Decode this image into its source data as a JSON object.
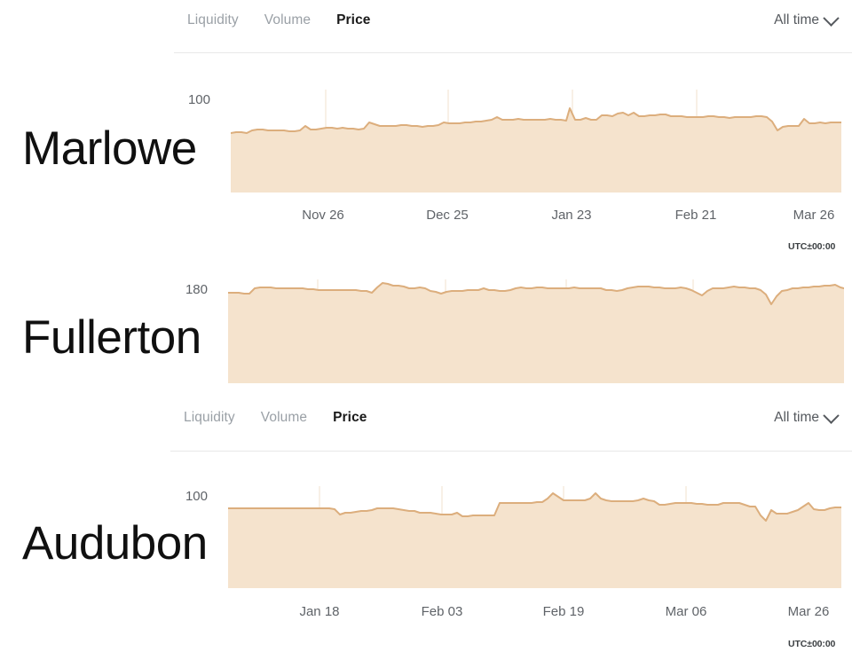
{
  "nav_primary": {
    "tabs": [
      {
        "label": "Liquidity",
        "active": false
      },
      {
        "label": "Volume",
        "active": false
      },
      {
        "label": "Price",
        "active": true
      }
    ],
    "range": {
      "label": "All time",
      "icon": "chevron-down-icon"
    }
  },
  "nav_secondary": {
    "tabs": [
      {
        "label": "Liquidity",
        "active": false
      },
      {
        "label": "Volume",
        "active": false
      },
      {
        "label": "Price",
        "active": true
      }
    ],
    "range": {
      "label": "All time",
      "icon": "chevron-down-icon"
    }
  },
  "colors": {
    "area_fill": "#f5e3cd",
    "area_stroke": "#dcae7d",
    "gridline": "#f1e2ce",
    "tab_inactive": "#9aa0a6",
    "tab_active": "#1a1a1a",
    "axis_text": "#5f6368"
  },
  "chart_data": [
    {
      "type": "area",
      "title": "Marlowe",
      "ylabel": "",
      "xlabel": "",
      "ylim": [
        0,
        100
      ],
      "y_ticks": [
        "100"
      ],
      "grid": true,
      "timezone": "UTC±00:00",
      "categories": [
        "Nov 26",
        "Dec 25",
        "Jan 23",
        "Feb 21",
        "Mar 26"
      ],
      "values": [
        62,
        63,
        63,
        62,
        65,
        66,
        66,
        65,
        65,
        65,
        65,
        64,
        64,
        65,
        70,
        66,
        66,
        67,
        68,
        68,
        67,
        68,
        67,
        67,
        66,
        67,
        73,
        71,
        69,
        69,
        69,
        69,
        70,
        70,
        69,
        69,
        68,
        69,
        69,
        70,
        73,
        72,
        72,
        72,
        73,
        73,
        74,
        74,
        75,
        76,
        78,
        76,
        76,
        76,
        77,
        76,
        76,
        76,
        76,
        76,
        77,
        76,
        76,
        75,
        86,
        76,
        76,
        78,
        76,
        76,
        80,
        80,
        79,
        82,
        83,
        80,
        83,
        79,
        79,
        80,
        80,
        81,
        81,
        79,
        79,
        79,
        78,
        78,
        78,
        78,
        79,
        79,
        78,
        78,
        77,
        78,
        78,
        78,
        78,
        78,
        79,
        79,
        78,
        74,
        66,
        69,
        70,
        70,
        70,
        76,
        72,
        72,
        73,
        72,
        73
      ],
      "x_positions_pct": [
        18.0,
        35.5,
        53.0,
        70.5,
        95.5
      ]
    },
    {
      "type": "area",
      "title": "Fullerton",
      "ylabel": "",
      "xlabel": "",
      "ylim": [
        0,
        180
      ],
      "y_ticks": [
        "180"
      ],
      "grid": true,
      "timezone": "",
      "categories": [],
      "values": [
        160,
        160,
        160,
        159,
        159,
        163,
        164,
        164,
        164,
        163,
        163,
        163,
        163,
        163,
        163,
        162,
        162,
        161,
        161,
        161,
        161,
        161,
        161,
        161,
        161,
        160,
        160,
        159,
        163,
        167,
        166,
        165,
        165,
        164,
        163,
        163,
        164,
        163,
        161,
        160,
        159,
        160,
        161,
        161,
        161,
        162,
        162,
        162,
        163,
        162,
        162,
        161,
        161,
        162,
        163,
        164,
        163,
        163,
        164,
        164,
        163,
        163,
        163,
        163,
        163,
        164,
        163,
        163,
        163,
        163,
        163,
        162,
        162,
        161,
        162,
        163,
        164,
        165,
        165,
        165,
        164,
        164,
        163,
        163,
        163,
        164,
        163,
        162,
        160,
        158,
        161,
        163,
        163,
        163,
        164,
        165,
        164,
        164,
        163,
        163,
        162,
        159,
        152,
        158,
        161,
        162,
        163,
        163,
        164,
        164,
        165,
        165,
        166,
        164
      ],
      "x_positions_pct": []
    },
    {
      "type": "area",
      "title": "Audubon",
      "ylabel": "",
      "xlabel": "",
      "ylim": [
        0,
        100
      ],
      "y_ticks": [
        "100"
      ],
      "grid": true,
      "timezone": "UTC±00:00",
      "categories": [
        "Jan 18",
        "Feb 03",
        "Feb 19",
        "Mar 06",
        "Mar 26"
      ],
      "values": [
        78,
        78,
        78,
        78,
        78,
        78,
        78,
        78,
        78,
        78,
        78,
        78,
        78,
        78,
        78,
        78,
        78,
        78,
        78,
        78,
        77,
        74,
        75,
        75,
        76,
        76,
        76,
        77,
        78,
        78,
        78,
        78,
        77,
        77,
        76,
        76,
        75,
        75,
        75,
        74,
        74,
        74,
        74,
        75,
        73,
        73,
        73,
        73,
        73,
        73,
        73,
        80,
        80,
        80,
        80,
        80,
        80,
        80,
        81,
        81,
        83,
        86,
        84,
        82,
        82,
        82,
        82,
        82,
        83,
        86,
        83,
        82,
        81,
        81,
        81,
        81,
        81,
        82,
        83,
        82,
        81,
        79,
        79,
        80,
        80,
        80,
        80,
        80,
        79,
        79,
        79,
        79,
        80,
        80,
        80,
        80,
        79,
        78,
        78,
        73,
        70,
        76,
        74,
        74,
        74,
        75,
        76,
        78,
        80,
        77,
        76,
        76,
        77,
        78,
        78
      ],
      "x_positions_pct": [
        16.0,
        35.0,
        54.0,
        74.0,
        95.0
      ]
    }
  ]
}
